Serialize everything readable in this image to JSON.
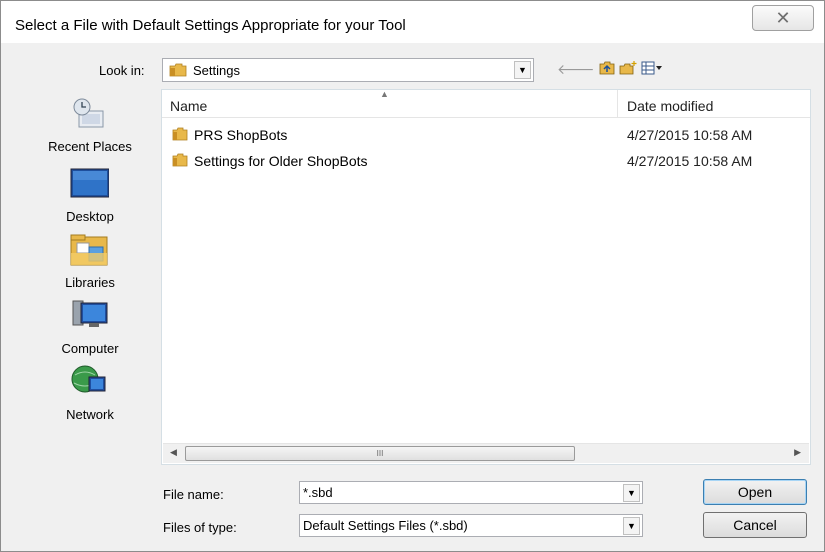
{
  "dialog": {
    "title": "Select a File with Default Settings Appropriate for your Tool",
    "close_glyph": "✕"
  },
  "lookin": {
    "label": "Look in:",
    "value": "Settings"
  },
  "toolbar": {
    "icons": [
      "back-icon",
      "up-folder-icon",
      "new-folder-icon",
      "view-menu-icon"
    ]
  },
  "places": [
    {
      "label": "Recent Places",
      "icon": "recent-places-icon"
    },
    {
      "label": "Desktop",
      "icon": "desktop-icon"
    },
    {
      "label": "Libraries",
      "icon": "libraries-icon"
    },
    {
      "label": "Computer",
      "icon": "computer-icon"
    },
    {
      "label": "Network",
      "icon": "network-icon"
    }
  ],
  "filelist": {
    "columns": {
      "name": "Name",
      "date": "Date modified"
    },
    "rows": [
      {
        "name": "PRS ShopBots",
        "date": "4/27/2015 10:58 AM"
      },
      {
        "name": "Settings for Older ShopBots",
        "date": "4/27/2015 10:58 AM"
      }
    ],
    "scroll_thumb_grip": "III"
  },
  "filename": {
    "label": "File name:",
    "value": "*.sbd"
  },
  "filetype": {
    "label": "Files of type:",
    "value": "Default Settings Files (*.sbd)"
  },
  "buttons": {
    "open": "Open",
    "cancel": "Cancel"
  },
  "colors": {
    "folder": "#e8b84a",
    "title_bg": "#ffffff",
    "dialog_bg": "#f0f0f0"
  }
}
